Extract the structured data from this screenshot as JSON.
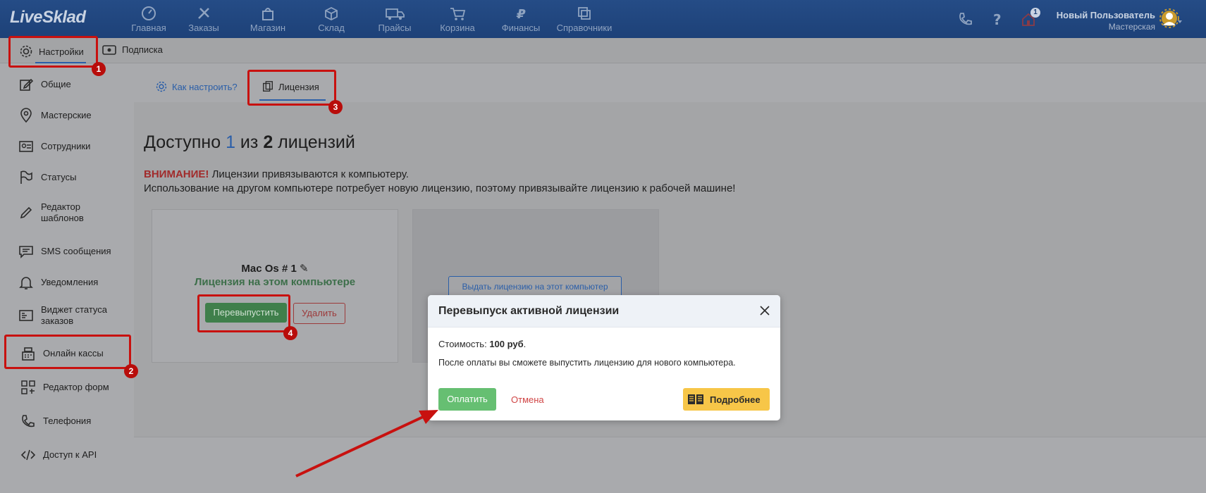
{
  "app": {
    "logo": "LiveSklad"
  },
  "nav": {
    "items": [
      {
        "label": "Главная",
        "icon": "dashboard-icon"
      },
      {
        "label": "Заказы",
        "icon": "tools-icon"
      },
      {
        "label": "Магазин",
        "icon": "shop-bag-icon"
      },
      {
        "label": "Склад",
        "icon": "box-icon"
      },
      {
        "label": "Прайсы",
        "icon": "truck-icon"
      },
      {
        "label": "Корзина",
        "icon": "cart-icon"
      },
      {
        "label": "Финансы",
        "icon": "ruble-icon"
      },
      {
        "label": "Справочники",
        "icon": "copy-icon"
      }
    ],
    "notification_count": "1",
    "user_name": "Новый Пользователь",
    "user_role": "Мастерская"
  },
  "subnav": {
    "settings": "Настройки",
    "subscription": "Подписка"
  },
  "sidebar": {
    "items": [
      {
        "label": "Общие",
        "icon": "edit-icon"
      },
      {
        "label": "Мастерские",
        "icon": "location-pin-icon"
      },
      {
        "label": "Сотрудники",
        "icon": "id-card-icon"
      },
      {
        "label": "Статусы",
        "icon": "flag-icon"
      },
      {
        "label": "Редактор шаблонов",
        "icon": "pencil-icon"
      },
      {
        "label": "SMS сообщения",
        "icon": "sms-icon"
      },
      {
        "label": "Уведомления",
        "icon": "bell-icon"
      },
      {
        "label": "Виджет статуса заказов",
        "icon": "widget-icon"
      },
      {
        "label": "Онлайн кассы",
        "icon": "cash-register-icon"
      },
      {
        "label": "Редактор форм",
        "icon": "forms-icon"
      },
      {
        "label": "Телефония",
        "icon": "phone-icon"
      },
      {
        "label": "Доступ к API",
        "icon": "code-icon"
      }
    ]
  },
  "tabs": {
    "howto": "Как настроить?",
    "license": "Лицензия"
  },
  "license": {
    "headline_prefix": "Доступно",
    "available": "1",
    "headline_mid": "из",
    "total": "2",
    "headline_suffix": "лицензий",
    "warning_label": "ВНИМАНИЕ!",
    "warning_line1": "Лицензии привязываются к компьютеру.",
    "warning_line2": "Использование на другом компьютере потребует новую лицензию, поэтому привязывайте лицензию к рабочей машине!",
    "card1_title": "Mac Os # 1",
    "card1_status": "Лицензия на этом компьютере",
    "reissue_button": "Перевыпустить",
    "delete_button": "Удалить",
    "card2_button": "Выдать лицензию на этот компьютер"
  },
  "modal": {
    "title": "Перевыпуск активной лицензии",
    "cost_label": "Стоимость:",
    "cost_value": "100 руб",
    "cost_end": ".",
    "description": "После оплаты вы сможете выпустить лицензию для нового компьютера.",
    "pay_button": "Оплатить",
    "cancel_button": "Отмена",
    "more_button": "Подробнее"
  },
  "annotations": {
    "m1": "1",
    "m2": "2",
    "m3": "3",
    "m4": "4"
  },
  "colors": {
    "topbar": "#1d4178",
    "annotation_red": "#c8110f",
    "pay_green": "#66bf72",
    "more_yellow": "#f7c648",
    "accent_blue": "#2a5ea8"
  }
}
